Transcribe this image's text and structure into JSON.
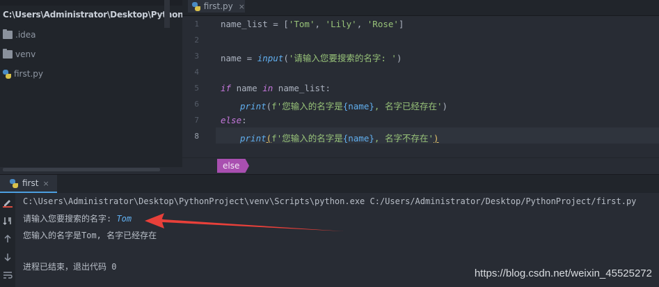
{
  "sidebar": {
    "project_path": "C:\\Users\\Administrator\\Desktop\\PythonProject",
    "items": [
      {
        "label": ".idea",
        "icon": "folder-icon"
      },
      {
        "label": "venv",
        "icon": "folder-icon"
      },
      {
        "label": "first.py",
        "icon": "python-file-icon"
      }
    ]
  },
  "editor": {
    "tab": {
      "label": "first.py",
      "close": "×"
    },
    "line_numbers": [
      "1",
      "2",
      "3",
      "4",
      "5",
      "6",
      "7",
      "8"
    ],
    "code": {
      "l1_a": "name_list = [",
      "l1_s1": "'Tom'",
      "l1_c1": ", ",
      "l1_s2": "'Lily'",
      "l1_c2": ", ",
      "l1_s3": "'Rose'",
      "l1_e": "]",
      "l3_a": "name = ",
      "l3_fn": "input",
      "l3_p": "(",
      "l3_s": "'请输入您要搜索的名字: '",
      "l3_e": ")",
      "l5_kw1": "if",
      "l5_a": " name ",
      "l5_kw2": "in",
      "l5_b": " name_list:",
      "l6_fn": "print",
      "l6_p": "(",
      "l6_s1": "f'您输入的名字是",
      "l6_v": "{name}",
      "l6_s2": ", 名字已经存在'",
      "l6_e": ")",
      "l7_kw": "else",
      "l7_e": ":",
      "l8_fn": "print",
      "l8_p": "(",
      "l8_s1": "f'您输入的名字是",
      "l8_v": "{name}",
      "l8_s2": ", 名字不存在'",
      "l8_e": ")"
    },
    "breadcrumb": "else"
  },
  "run": {
    "tab": {
      "label": "first",
      "close": "×"
    },
    "console": {
      "command": "C:\\Users\\Administrator\\Desktop\\PythonProject\\venv\\Scripts\\python.exe C:/Users/Administrator/Desktop/PythonProject/first.py",
      "prompt": "请输入您要搜索的名字: ",
      "input": "Tom",
      "result": "您输入的名字是Tom, 名字已经存在",
      "exit": "进程已结束，退出代码 0"
    }
  },
  "watermark": "https://blog.csdn.net/weixin_45525272",
  "colors": {
    "annotation_arrow": "#e8403a",
    "keyword": "#c678dd",
    "string": "#98c379",
    "function": "#61afef",
    "breadcrumb": "#a94fb0"
  }
}
